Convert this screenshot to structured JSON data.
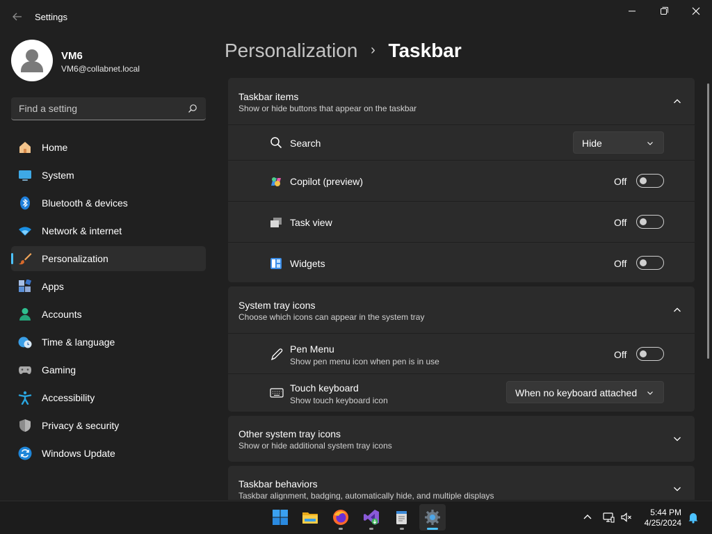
{
  "app": {
    "title": "Settings",
    "back_icon": "arrow-left-icon",
    "window_controls": [
      "minimize-icon",
      "restore-icon",
      "close-icon"
    ]
  },
  "profile": {
    "name": "VM6",
    "email": "VM6@collabnet.local"
  },
  "search": {
    "placeholder": "Find a setting",
    "value": ""
  },
  "sidebar": {
    "items": [
      {
        "label": "Home",
        "icon": "home-icon",
        "active": false
      },
      {
        "label": "System",
        "icon": "monitor-icon",
        "active": false
      },
      {
        "label": "Bluetooth & devices",
        "icon": "bluetooth-icon",
        "active": false
      },
      {
        "label": "Network & internet",
        "icon": "wifi-icon",
        "active": false
      },
      {
        "label": "Personalization",
        "icon": "paintbrush-icon",
        "active": true
      },
      {
        "label": "Apps",
        "icon": "apps-icon",
        "active": false
      },
      {
        "label": "Accounts",
        "icon": "person-icon",
        "active": false
      },
      {
        "label": "Time & language",
        "icon": "clock-globe-icon",
        "active": false
      },
      {
        "label": "Gaming",
        "icon": "gamepad-icon",
        "active": false
      },
      {
        "label": "Accessibility",
        "icon": "accessibility-icon",
        "active": false
      },
      {
        "label": "Privacy & security",
        "icon": "shield-icon",
        "active": false
      },
      {
        "label": "Windows Update",
        "icon": "update-icon",
        "active": false
      }
    ]
  },
  "breadcrumb": {
    "parent": "Personalization",
    "separator": "›",
    "current": "Taskbar"
  },
  "sections": {
    "taskbar_items": {
      "title": "Taskbar items",
      "subtitle": "Show or hide buttons that appear on the taskbar",
      "expanded": true,
      "rows": {
        "search": {
          "label": "Search",
          "icon": "search-icon",
          "control": "dropdown",
          "value": "Hide"
        },
        "copilot": {
          "label": "Copilot (preview)",
          "icon": "copilot-icon",
          "control": "toggle",
          "state": "Off"
        },
        "task_view": {
          "label": "Task view",
          "icon": "task-view-icon",
          "control": "toggle",
          "state": "Off"
        },
        "widgets": {
          "label": "Widgets",
          "icon": "widgets-icon",
          "control": "toggle",
          "state": "Off"
        }
      }
    },
    "system_tray_icons": {
      "title": "System tray icons",
      "subtitle": "Choose which icons can appear in the system tray",
      "expanded": true,
      "rows": {
        "pen_menu": {
          "label": "Pen Menu",
          "sublabel": "Show pen menu icon when pen is in use",
          "icon": "pen-icon",
          "control": "toggle",
          "state": "Off"
        },
        "touch_keyboard": {
          "label": "Touch keyboard",
          "sublabel": "Show touch keyboard icon",
          "icon": "keyboard-icon",
          "control": "dropdown",
          "value": "When no keyboard attached"
        }
      }
    },
    "other_tray_icons": {
      "title": "Other system tray icons",
      "subtitle": "Show or hide additional system tray icons",
      "expanded": false
    },
    "taskbar_behaviors": {
      "title": "Taskbar behaviors",
      "subtitle": "Taskbar alignment, badging, automatically hide, and multiple displays",
      "expanded": false
    }
  },
  "taskbar": {
    "apps": [
      {
        "icon": "windows-start-icon",
        "running": false,
        "active": false
      },
      {
        "icon": "file-explorer-icon",
        "running": false,
        "active": false
      },
      {
        "icon": "firefox-icon",
        "running": true,
        "active": false
      },
      {
        "icon": "visual-studio-icon",
        "running": true,
        "active": false
      },
      {
        "icon": "notepad-icon",
        "running": true,
        "active": false
      },
      {
        "icon": "settings-gear-icon",
        "running": true,
        "active": true
      }
    ],
    "tray": [
      "chevron-up-icon",
      "network-icon",
      "volume-muted-icon",
      "notification-bell-icon"
    ],
    "time": "5:44 PM",
    "date": "4/25/2024"
  },
  "colors": {
    "background": "#202020",
    "card": "#2b2b2b",
    "accent": "#4cc2ff",
    "taskbar": "#1c1c1c"
  }
}
